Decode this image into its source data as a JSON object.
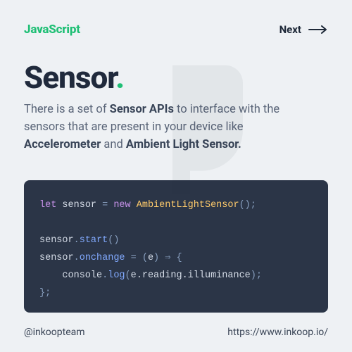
{
  "colors": {
    "accent": "#1fbf75",
    "bg": "#eef1f4",
    "code_bg": "#2b3547",
    "text": "#2d3748"
  },
  "topbar": {
    "brand": "JavaScript",
    "next_label": "Next"
  },
  "hero": {
    "title": "Sensor",
    "dot": "."
  },
  "description": {
    "pre": "There is a set of ",
    "bold1": "Sensor APIs",
    "mid": " to interface with the sensors that are present in your device like ",
    "bold2": "Accelerometer",
    "and": " and ",
    "bold3": "Ambient Light Sensor."
  },
  "code": {
    "l1_kw_let": "let",
    "l1_var": " sensor ",
    "l1_eq": "= ",
    "l1_kw_new": "new",
    "l1_sp": " ",
    "l1_cls": "AmbientLightSensor",
    "l1_paren": "();",
    "blank": "",
    "l3_obj": "sensor",
    "l3_dot": ".",
    "l3_start": "start",
    "l3_paren": "()",
    "l4_obj": "sensor",
    "l4_dot": ".",
    "l4_prop": "onchange",
    "l4_assign": " = (",
    "l4_e": "e",
    "l4_arrow": ") ⇒ {",
    "l5_indent": "    ",
    "l5_console": "console",
    "l5_dot": ".",
    "l5_log": "log",
    "l5_open": "(",
    "l5_arg": "e.reading.illuminance",
    "l5_close": ");",
    "l6_close": "};"
  },
  "footer": {
    "handle": "@inkoopteam",
    "url": "https://www.inkoop.io/"
  }
}
